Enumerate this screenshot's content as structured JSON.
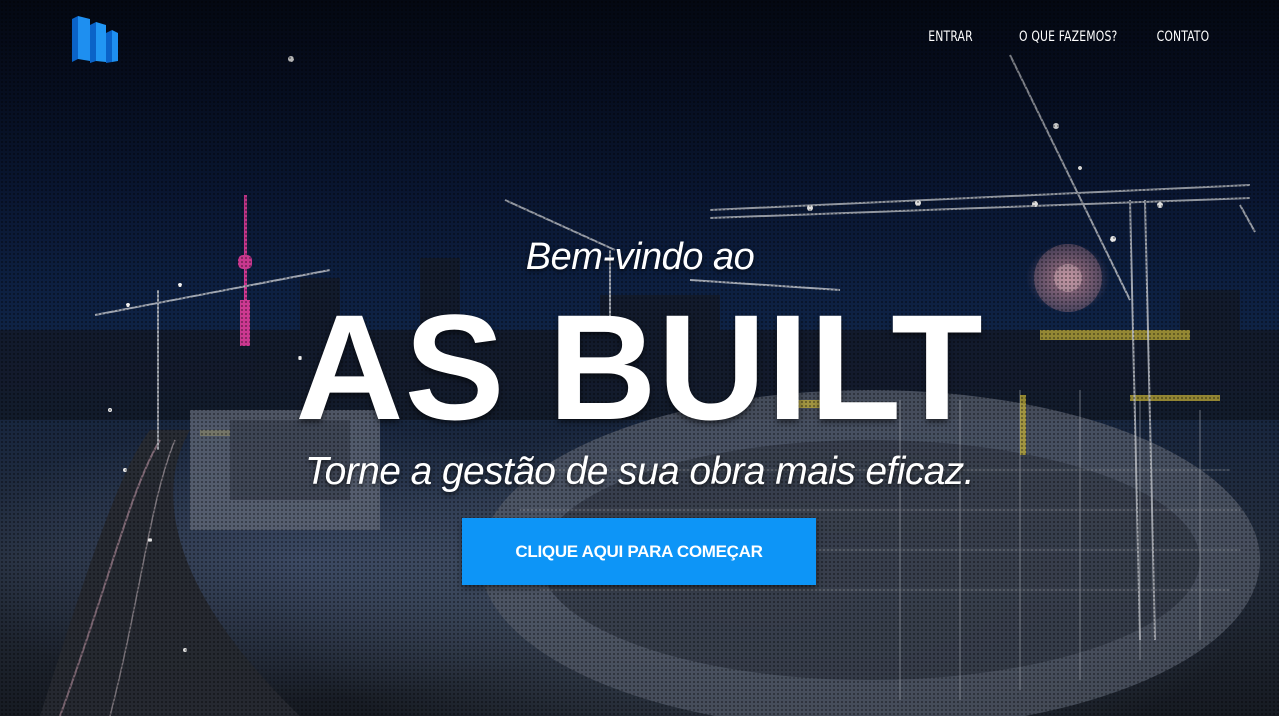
{
  "nav": {
    "items": [
      {
        "label": "ENTRAR"
      },
      {
        "label": "O QUE FAZEMOS?"
      },
      {
        "label": "CONTATO"
      }
    ]
  },
  "logo": {
    "icon": "building-blocks-icon",
    "color": "#1e8ff0"
  },
  "hero": {
    "welcome": "Bem-vindo ao",
    "title": "AS BUILT",
    "tagline": "Torne a gestão de sua obra mais eficaz.",
    "cta_label": "CLIQUE AQUI PARA COMEÇAR",
    "background": "night-construction-site-photo"
  },
  "colors": {
    "accent": "#0d95f7",
    "text": "#ffffff",
    "sky": "#0b1a3a"
  }
}
